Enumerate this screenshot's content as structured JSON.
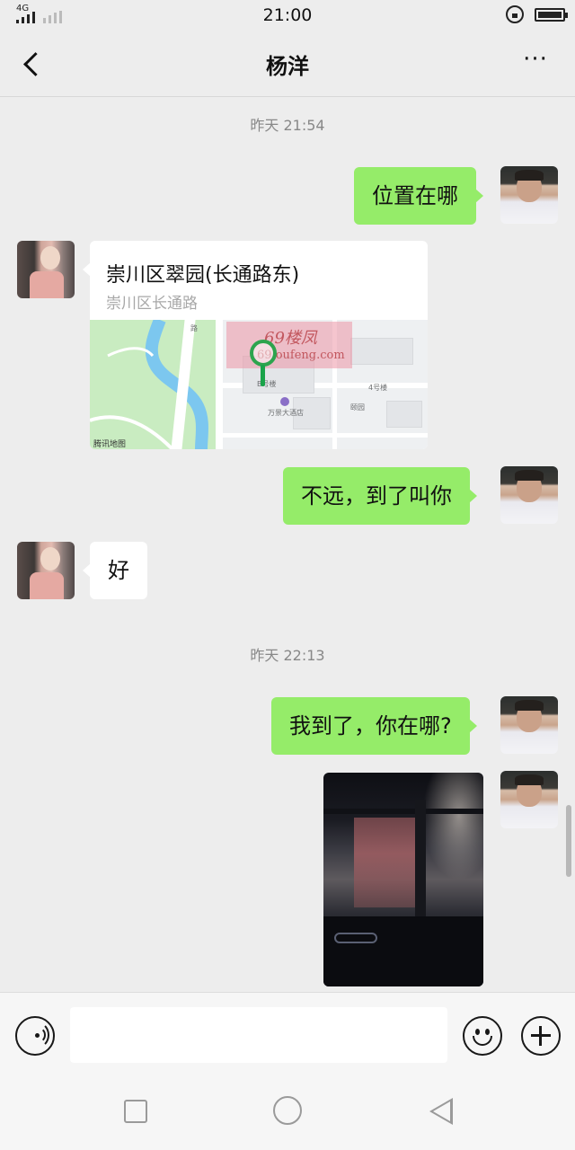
{
  "status_bar": {
    "network": "4G",
    "time": "21:00",
    "icons": [
      "signal-icon",
      "screen-lock-icon",
      "battery-icon"
    ]
  },
  "header": {
    "title": "杨洋",
    "back_icon": "chevron-left-icon",
    "more_icon": "more-icon",
    "more_label": "···"
  },
  "conversation": {
    "timestamp_1": "昨天 21:54",
    "msg_1": "位置在哪",
    "location": {
      "name": "崇川区翠园(长通路东)",
      "address": "崇川区长通路",
      "map_provider": "腾讯地图",
      "map_labels": [
        "万景大酒店",
        "4号楼",
        "B号楼",
        "颐园",
        "路"
      ],
      "watermark_1": "69楼凤",
      "watermark_2": "69loufeng.com"
    },
    "msg_2": "不远，到了叫你",
    "msg_3": "好",
    "timestamp_2": "昨天 22:13",
    "msg_4": "我到了，你在哪?"
  },
  "input_bar": {
    "voice_icon": "voice-icon",
    "emoji_icon": "emoji-icon",
    "plus_icon": "plus-icon",
    "text_value": ""
  },
  "nav_bar": {
    "icons": [
      "recent-apps-icon",
      "home-icon",
      "back-icon"
    ]
  },
  "colors": {
    "background": "#ededed",
    "sent_bubble": "#95ec69",
    "received_bubble": "#ffffff",
    "timestamp": "#888888"
  }
}
